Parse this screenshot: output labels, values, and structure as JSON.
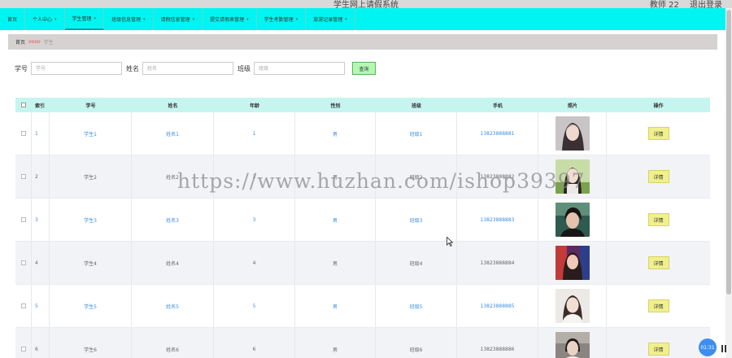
{
  "titlebar": {
    "app_title": "学生网上请假系统",
    "user_label": "教师 22",
    "logout_label": "退出登录"
  },
  "nav": {
    "items": [
      {
        "label": "首页",
        "caret": false,
        "active": false
      },
      {
        "label": "个人中心",
        "caret": true,
        "active": false
      },
      {
        "label": "学生管理",
        "caret": true,
        "active": true
      },
      {
        "label": "班级信息管理",
        "caret": true,
        "active": false
      },
      {
        "label": "请假信息管理",
        "caret": true,
        "active": false
      },
      {
        "label": "提交请假表管理",
        "caret": true,
        "active": false
      },
      {
        "label": "学生考勤管理",
        "caret": true,
        "active": false
      },
      {
        "label": "旅游记录管理",
        "caret": true,
        "active": false
      }
    ]
  },
  "breadcrumb": {
    "home": "首页",
    "separator": "oooo",
    "current": "学生"
  },
  "search": {
    "student_no_label": "学号",
    "student_no_placeholder": "学号",
    "name_label": "姓名",
    "name_placeholder": "姓名",
    "class_label": "班级",
    "class_placeholder": "班级",
    "query_button": "查询"
  },
  "table": {
    "headers": [
      "索引",
      "学号",
      "姓名",
      "年龄",
      "性别",
      "班级",
      "手机",
      "照片",
      "操作"
    ],
    "rows": [
      {
        "index": "1",
        "student_no": "学生1",
        "name": "姓名1",
        "age": "1",
        "gender": "男",
        "class": "班级1",
        "phone": "13823888881",
        "action": "详情",
        "linked": true
      },
      {
        "index": "2",
        "student_no": "学生2",
        "name": "姓名2",
        "age": "2",
        "gender": "男",
        "class": "班级2",
        "phone": "13823888882",
        "action": "详情",
        "linked": false
      },
      {
        "index": "3",
        "student_no": "学生3",
        "name": "姓名3",
        "age": "3",
        "gender": "男",
        "class": "班级3",
        "phone": "13823888883",
        "action": "详情",
        "linked": true
      },
      {
        "index": "4",
        "student_no": "学生4",
        "name": "姓名4",
        "age": "4",
        "gender": "男",
        "class": "班级4",
        "phone": "13823888884",
        "action": "详情",
        "linked": false
      },
      {
        "index": "5",
        "student_no": "学生5",
        "name": "姓名5",
        "age": "5",
        "gender": "男",
        "class": "班级5",
        "phone": "13823888885",
        "action": "详情",
        "linked": true
      },
      {
        "index": "6",
        "student_no": "学生6",
        "name": "姓名6",
        "age": "6",
        "gender": "男",
        "class": "班级6",
        "phone": "13823888886",
        "action": "详情",
        "linked": false
      }
    ]
  },
  "watermark": "https://www.huzhan.com/ishop39397",
  "float_widget": "01:31",
  "colors": {
    "nav_bg": "#00f5f0",
    "table_header_bg": "#c6f5f0",
    "link": "#3a8ee6",
    "action_button_bg": "#f0f08c",
    "query_button_bg": "#b3f7b3"
  }
}
